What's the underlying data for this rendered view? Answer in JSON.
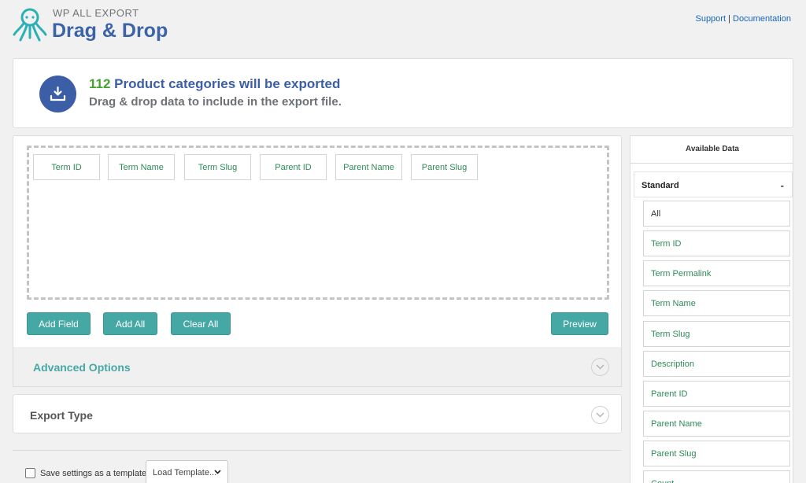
{
  "header": {
    "brand_small": "WP ALL EXPORT",
    "brand_big": "Drag & Drop",
    "support_link": "Support",
    "separator": "|",
    "documentation_link": "Documentation"
  },
  "summary": {
    "count": "112",
    "line1_rest": " Product categories will be exported",
    "line2": "Drag & drop data to include in the export file."
  },
  "selected_fields": [
    "Term ID",
    "Term Name",
    "Term Slug",
    "Parent ID",
    "Parent Name",
    "Parent Slug"
  ],
  "buttons": {
    "add_field": "Add Field",
    "add_all": "Add All",
    "clear_all": "Clear All",
    "preview": "Preview"
  },
  "sections": {
    "advanced_options": "Advanced Options",
    "export_type": "Export Type"
  },
  "footer": {
    "save_template_label": "Save settings as a template",
    "load_template": "Load Template..."
  },
  "available_data": {
    "title": "Available Data",
    "group_label": "Standard",
    "group_toggle": "-",
    "items": [
      "All",
      "Term ID",
      "Term Permalink",
      "Term Name",
      "Term Slug",
      "Description",
      "Parent ID",
      "Parent Name",
      "Parent Slug",
      "Count"
    ]
  },
  "colors": {
    "accent_teal": "#46a8a5",
    "brand_blue": "#3b5ea7",
    "count_green": "#46a32f",
    "field_green": "#2e8b57"
  }
}
